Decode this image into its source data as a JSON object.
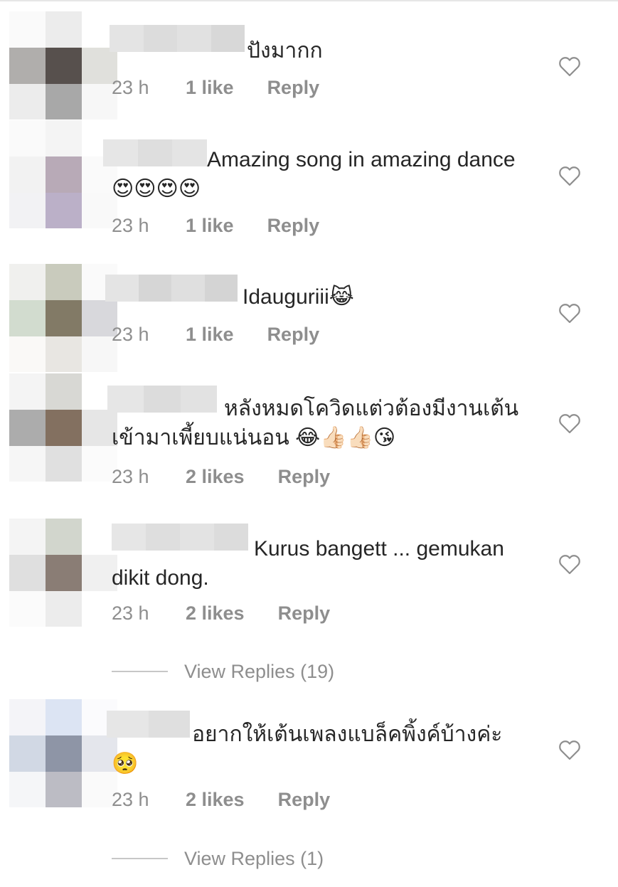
{
  "comments": [
    {
      "text": "ปังมากก",
      "time": "23 h",
      "likes": "1 like",
      "reply": "Reply",
      "liked": false
    },
    {
      "text": "Amazing song in amazing dance😍😍😍😍",
      "time": "23 h",
      "likes": "1 like",
      "reply": "Reply",
      "liked": false
    },
    {
      "text": "Idauguriii😹",
      "time": "23 h",
      "likes": "1 like",
      "reply": "Reply",
      "liked": false
    },
    {
      "text": "หลังหมดโควิดแต่วต้องมีงานเต้นเข้ามาเพี้ยบแน่นอน 😂👍🏻👍🏻😘",
      "time": "23 h",
      "likes": "2 likes",
      "reply": "Reply",
      "liked": false
    },
    {
      "text": "Kurus bangett ... gemukan dikit dong.",
      "time": "23 h",
      "likes": "2 likes",
      "reply": "Reply",
      "liked": false,
      "view_replies": "View Replies (19)"
    },
    {
      "text": "อยากให้เต้นเพลงแบล็คพิ้งค์บ้างค่ะ 🥺",
      "time": "23 h",
      "likes": "2 likes",
      "reply": "Reply",
      "liked": false,
      "view_replies": "View Replies (1)"
    }
  ],
  "colors": {
    "text": "#262626",
    "secondary": "#8e8e8e",
    "divider": "#c7c7c7",
    "heart_outline": "#8e8e8e"
  }
}
